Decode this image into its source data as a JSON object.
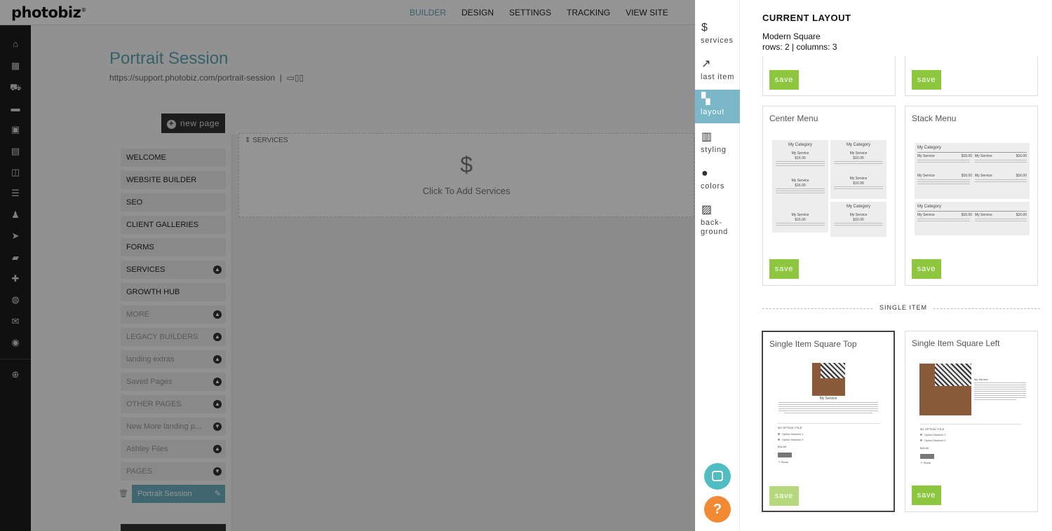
{
  "app": {
    "logo": "photobiz",
    "logo_mark": "®",
    "top_nav": [
      "BUILDER",
      "DESIGN",
      "SETTINGS",
      "TRACKING",
      "VIEW SITE"
    ],
    "page_title": "Portrait Session",
    "page_url": "https://support.photobiz.com/portrait-session",
    "new_page_label": "new page",
    "nav_items": [
      {
        "label": "WELCOME",
        "chevron": false,
        "muted": false
      },
      {
        "label": "WEBSITE BUILDER",
        "chevron": false,
        "muted": false
      },
      {
        "label": "SEO",
        "chevron": false,
        "muted": false
      },
      {
        "label": "CLIENT GALLERIES",
        "chevron": false,
        "muted": false
      },
      {
        "label": "FORMS",
        "chevron": false,
        "muted": false
      },
      {
        "label": "SERVICES",
        "chevron": true,
        "muted": false
      },
      {
        "label": "GROWTH HUB",
        "chevron": false,
        "muted": false
      },
      {
        "label": "MORE",
        "chevron": true,
        "muted": true
      },
      {
        "label": "LEGACY BUILDERS",
        "chevron": true,
        "muted": true
      },
      {
        "label": "landing extras",
        "chevron": true,
        "muted": true
      },
      {
        "label": "Saved Pages",
        "chevron": true,
        "muted": true
      },
      {
        "label": "OTHER PAGES",
        "chevron": true,
        "muted": true
      },
      {
        "label": "New More landing p...",
        "chevron": true,
        "muted": true
      },
      {
        "label": "Ashley Files",
        "chevron": true,
        "muted": true
      },
      {
        "label": "PAGES",
        "chevron": true,
        "muted": true
      }
    ],
    "active_page": "Portrait Session",
    "services_block": {
      "label": "SERVICES",
      "icon": "$",
      "cta": "Click To Add Services"
    }
  },
  "rail": [
    {
      "key": "services",
      "label": "services",
      "glyph": "$"
    },
    {
      "key": "last-item",
      "label": "last item",
      "glyph": "↗"
    },
    {
      "key": "layout",
      "label": "layout",
      "glyph": "▚",
      "active": true
    },
    {
      "key": "styling",
      "label": "styling",
      "glyph": "▥"
    },
    {
      "key": "colors",
      "label": "colors",
      "glyph": "●"
    },
    {
      "key": "background",
      "label": "back-\nground",
      "glyph": "▨"
    }
  ],
  "panel": {
    "heading": "CURRENT LAYOUT",
    "current_name": "Modern Square",
    "current_dims": "rows: 2 | columns: 3",
    "save_label": "save",
    "layouts": [
      {
        "title": "Center Menu"
      },
      {
        "title": "Stack Menu"
      },
      {
        "title": "Single Item Square Top",
        "selected": true
      },
      {
        "title": "Single Item Square Left"
      }
    ],
    "section_single": "SINGLE ITEM",
    "preview": {
      "category": "My Category",
      "service": "My Service",
      "price": "$16.00",
      "price_alt": "$16.99",
      "option_title": "MY OPTION TITLE",
      "option1": "Option Number 1",
      "option2": "Option Number 2",
      "add_btn": "Add to Cart",
      "share": "Share"
    }
  },
  "colors": {
    "accent": "#5ea5b7",
    "save_green": "#8dc63f",
    "rail_active": "#7ab8c9",
    "chat": "#4fbdc1",
    "help": "#f28a34"
  }
}
